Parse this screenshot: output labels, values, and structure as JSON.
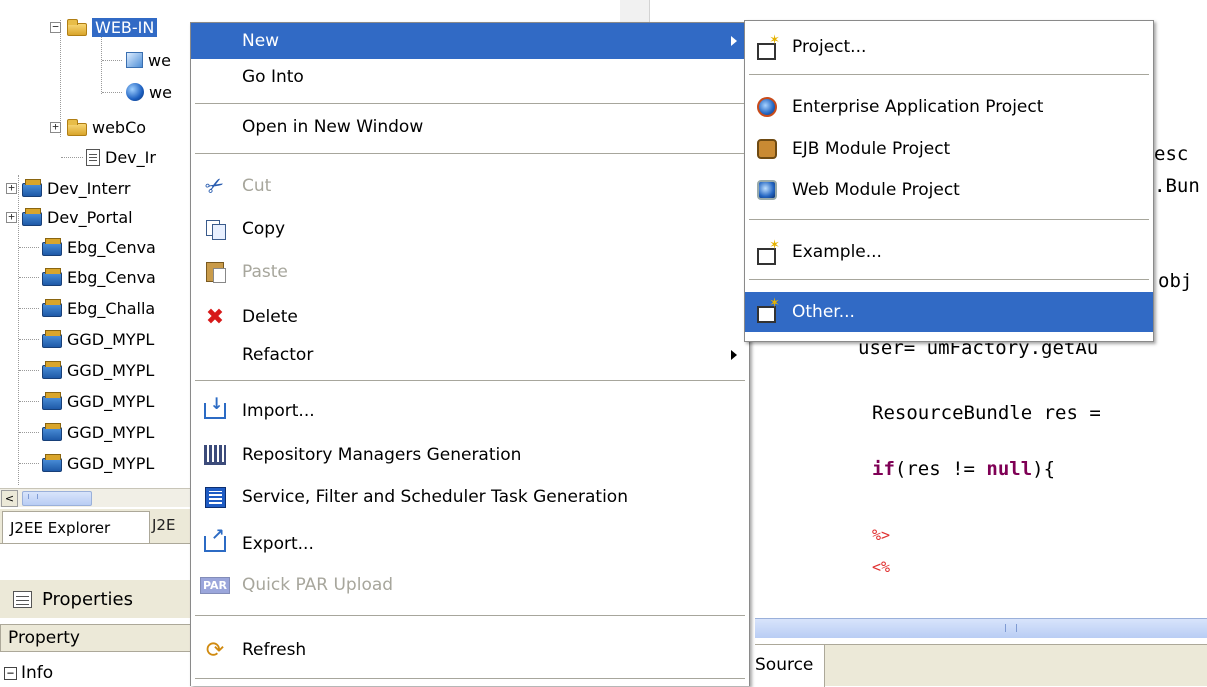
{
  "tree": {
    "items": [
      {
        "label": "WEB-IN",
        "type": "folder",
        "selected": true
      },
      {
        "label": "we",
        "type": "webcfg"
      },
      {
        "label": "we",
        "type": "globe"
      },
      {
        "label": "webCo",
        "type": "folder"
      },
      {
        "label": "Dev_Ir",
        "type": "doc"
      },
      {
        "label": "Dev_Interr",
        "type": "project"
      },
      {
        "label": "Dev_Portal",
        "type": "project"
      },
      {
        "label": "Ebg_Cenva",
        "type": "project"
      },
      {
        "label": "Ebg_Cenva",
        "type": "project"
      },
      {
        "label": "Ebg_Challa",
        "type": "project"
      },
      {
        "label": "GGD_MYPL",
        "type": "project"
      },
      {
        "label": "GGD_MYPL",
        "type": "project"
      },
      {
        "label": "GGD_MYPL",
        "type": "project"
      },
      {
        "label": "GGD_MYPL",
        "type": "project"
      },
      {
        "label": "GGD_MYPL",
        "type": "project"
      }
    ],
    "scroll_left_glyph": "<",
    "scroll_grip": "III"
  },
  "bottom_tabs": {
    "active": "J2EE Explorer",
    "other": "J2E"
  },
  "properties": {
    "title": "Properties",
    "column": "Property",
    "row": "Info",
    "row_expander": "−"
  },
  "editor": {
    "lines": {
      "res_fragment": "esc",
      "bun_fragment": ".Bun",
      "obj_fragment": "obj",
      "user_line": "user= umFactory.getAu",
      "resourcebundle_line": "ResourceBundle res =",
      "if_kw": "if",
      "if_mid": "(res != ",
      "null_kw": "null",
      "if_end": "){",
      "jsp_close": "%>",
      "jsp_open": "<%"
    },
    "tab_label": "Source",
    "scroll_grip": "III"
  },
  "context_menu": {
    "items": [
      {
        "label": "New",
        "icon": "none",
        "submenu": true,
        "highlighted": true
      },
      {
        "label": "Go Into",
        "icon": "none"
      },
      {
        "label": "Open in New Window",
        "icon": "none"
      },
      {
        "label": "Cut",
        "icon": "scissors-icon",
        "disabled": true
      },
      {
        "label": "Copy",
        "icon": "copy-icon"
      },
      {
        "label": "Paste",
        "icon": "paste-icon",
        "disabled": true
      },
      {
        "label": "Delete",
        "icon": "delete-icon"
      },
      {
        "label": "Refactor",
        "icon": "none",
        "submenu": true
      },
      {
        "label": "Import...",
        "icon": "import-icon"
      },
      {
        "label": "Repository Managers Generation",
        "icon": "repository-icon"
      },
      {
        "label": "Service, Filter and Scheduler Task Generation",
        "icon": "service-icon"
      },
      {
        "label": "Export...",
        "icon": "export-icon"
      },
      {
        "label": "Quick PAR Upload",
        "icon": "par-icon",
        "disabled": true
      },
      {
        "label": "Refresh",
        "icon": "refresh-icon"
      }
    ]
  },
  "new_submenu": {
    "items": [
      {
        "label": "Project...",
        "icon": "wizard-icon"
      },
      {
        "label": "Enterprise Application Project",
        "icon": "enterprise-app-icon"
      },
      {
        "label": "EJB Module Project",
        "icon": "ejb-module-icon"
      },
      {
        "label": "Web Module Project",
        "icon": "web-module-icon"
      },
      {
        "label": "Example...",
        "icon": "wizard-icon"
      },
      {
        "label": "Other...",
        "icon": "wizard-icon",
        "highlighted": true
      }
    ]
  },
  "colors": {
    "selection": "#316ac5",
    "keyword": "#7f0055",
    "jsp_tag": "#e03030",
    "disabled_text": "#a7a69c"
  }
}
